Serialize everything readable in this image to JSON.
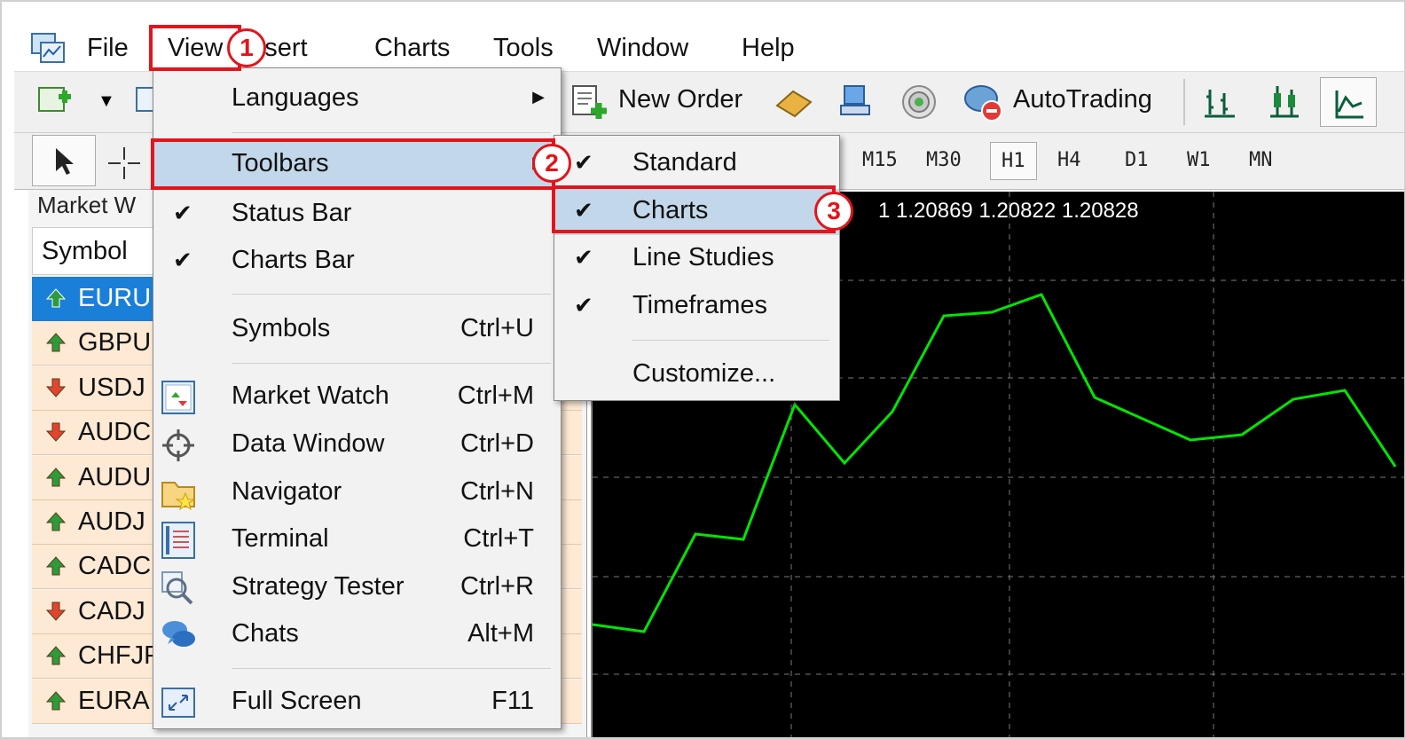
{
  "menubar": {
    "items": [
      "File",
      "View",
      "Insert",
      "Charts",
      "Tools",
      "Window",
      "Help"
    ]
  },
  "toolbar": {
    "new_order_label": "New Order",
    "autotrading_label": "AutoTrading",
    "timeframes": [
      "M15",
      "M30",
      "H1",
      "H4",
      "D1",
      "W1",
      "MN"
    ],
    "active_timeframe": "H1"
  },
  "market_watch": {
    "title": "Market W",
    "column_symbol": "Symbol",
    "rows": [
      {
        "symbol": "EURU",
        "direction": "up",
        "selected": true
      },
      {
        "symbol": "GBPU",
        "direction": "up",
        "selected": false
      },
      {
        "symbol": "USDJ",
        "direction": "down",
        "selected": false
      },
      {
        "symbol": "AUDC",
        "direction": "down",
        "selected": false
      },
      {
        "symbol": "AUDU",
        "direction": "up",
        "selected": false
      },
      {
        "symbol": "AUDJ",
        "direction": "up",
        "selected": false
      },
      {
        "symbol": "CADC",
        "direction": "up",
        "selected": false
      },
      {
        "symbol": "CADJ",
        "direction": "down",
        "selected": false
      },
      {
        "symbol": "CHFJP",
        "direction": "up",
        "selected": false
      },
      {
        "symbol": "EURA",
        "direction": "up",
        "selected": false
      }
    ]
  },
  "chart": {
    "info_text": "1 1.20869 1.20822 1.20828",
    "background": "#000000",
    "line_color": "#00e600"
  },
  "view_menu": {
    "items": [
      {
        "label": "Languages",
        "shortcut": "",
        "checked": false,
        "submenu": true
      },
      {
        "label": "Toolbars",
        "shortcut": "",
        "checked": false,
        "submenu": true,
        "highlighted": true
      },
      {
        "label": "Status Bar",
        "shortcut": "",
        "checked": true
      },
      {
        "label": "Charts Bar",
        "shortcut": "",
        "checked": true
      },
      {
        "label": "Symbols",
        "shortcut": "Ctrl+U",
        "checked": false
      },
      {
        "label": "Market Watch",
        "shortcut": "Ctrl+M",
        "checked": false,
        "icon": "market-watch-icon"
      },
      {
        "label": "Data Window",
        "shortcut": "Ctrl+D",
        "checked": false,
        "icon": "crosshair-icon"
      },
      {
        "label": "Navigator",
        "shortcut": "Ctrl+N",
        "checked": false,
        "icon": "navigator-folder-icon"
      },
      {
        "label": "Terminal",
        "shortcut": "Ctrl+T",
        "checked": false,
        "icon": "terminal-icon"
      },
      {
        "label": "Strategy Tester",
        "shortcut": "Ctrl+R",
        "checked": false,
        "icon": "strategy-tester-icon"
      },
      {
        "label": "Chats",
        "shortcut": "Alt+M",
        "checked": false,
        "icon": "chat-bubbles-icon"
      },
      {
        "label": "Full Screen",
        "shortcut": "F11",
        "checked": false,
        "icon": "full-screen-icon"
      }
    ]
  },
  "toolbars_submenu": {
    "items": [
      {
        "label": "Standard",
        "checked": true
      },
      {
        "label": "Charts",
        "checked": true,
        "highlighted": true
      },
      {
        "label": "Line Studies",
        "checked": true
      },
      {
        "label": "Timeframes",
        "checked": true
      },
      {
        "label": "Customize...",
        "checked": false
      }
    ]
  },
  "annotations": {
    "step1": "1",
    "step2": "2",
    "step3": "3",
    "color": "#e3141b"
  },
  "glyphs": {
    "check": "✔",
    "submenu_arrow": "▶"
  }
}
